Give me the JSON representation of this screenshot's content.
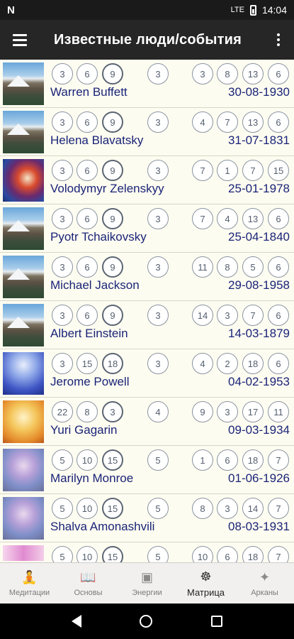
{
  "status": {
    "left_icon": "N",
    "signal": "LTE",
    "time": "14:04"
  },
  "app_bar": {
    "title": "Известные люди/события"
  },
  "rows": [
    {
      "name": "Warren Buffett",
      "date": "30-08-1930",
      "thumb": "mountain",
      "left": [
        "3",
        "6",
        "9"
      ],
      "mid": "3",
      "right": [
        "3",
        "8",
        "13",
        "6"
      ]
    },
    {
      "name": "Helena Blavatsky",
      "date": "31-07-1831",
      "thumb": "mountain",
      "left": [
        "3",
        "6",
        "9"
      ],
      "mid": "3",
      "right": [
        "4",
        "7",
        "13",
        "6"
      ]
    },
    {
      "name": "Volodymyr Zelenskyy",
      "date": "25-01-1978",
      "thumb": "swirl",
      "left": [
        "3",
        "6",
        "9"
      ],
      "mid": "3",
      "right": [
        "7",
        "1",
        "7",
        "15"
      ]
    },
    {
      "name": "Pyotr Tchaikovsky",
      "date": "25-04-1840",
      "thumb": "mountain",
      "left": [
        "3",
        "6",
        "9"
      ],
      "mid": "3",
      "right": [
        "7",
        "4",
        "13",
        "6"
      ]
    },
    {
      "name": "Michael Jackson",
      "date": "29-08-1958",
      "thumb": "mountain",
      "left": [
        "3",
        "6",
        "9"
      ],
      "mid": "3",
      "right": [
        "11",
        "8",
        "5",
        "6"
      ]
    },
    {
      "name": "Albert Einstein",
      "date": "14-03-1879",
      "thumb": "mountain",
      "left": [
        "3",
        "6",
        "9"
      ],
      "mid": "3",
      "right": [
        "14",
        "3",
        "7",
        "6"
      ]
    },
    {
      "name": "Jerome Powell",
      "date": "04-02-1953",
      "thumb": "blue-figure",
      "left": [
        "3",
        "15",
        "18"
      ],
      "mid": "3",
      "right": [
        "4",
        "2",
        "18",
        "6"
      ]
    },
    {
      "name": "Yuri Gagarin",
      "date": "09-03-1934",
      "thumb": "gold-figure",
      "left": [
        "22",
        "8",
        "3"
      ],
      "mid": "4",
      "right": [
        "9",
        "3",
        "17",
        "11"
      ]
    },
    {
      "name": "Marilyn Monroe",
      "date": "01-06-1926",
      "thumb": "shiva",
      "left": [
        "5",
        "10",
        "15"
      ],
      "mid": "5",
      "right": [
        "1",
        "6",
        "18",
        "7"
      ]
    },
    {
      "name": "Shalva Amonashvili",
      "date": "08-03-1931",
      "thumb": "shiva",
      "left": [
        "5",
        "10",
        "15"
      ],
      "mid": "5",
      "right": [
        "8",
        "3",
        "14",
        "7"
      ]
    },
    {
      "name": "",
      "date": "",
      "thumb": "pink",
      "left": [
        "5",
        "10",
        "15"
      ],
      "mid": "5",
      "right": [
        "10",
        "6",
        "18",
        "7"
      ]
    }
  ],
  "bottom_nav": [
    {
      "label": "Медитации",
      "icon": "meditation-icon"
    },
    {
      "label": "Основы",
      "icon": "book-icon"
    },
    {
      "label": "Энергии",
      "icon": "image-icon"
    },
    {
      "label": "Матрица",
      "icon": "dharma-wheel-icon",
      "active": true
    },
    {
      "label": "Арканы",
      "icon": "sparkle-icon"
    }
  ]
}
